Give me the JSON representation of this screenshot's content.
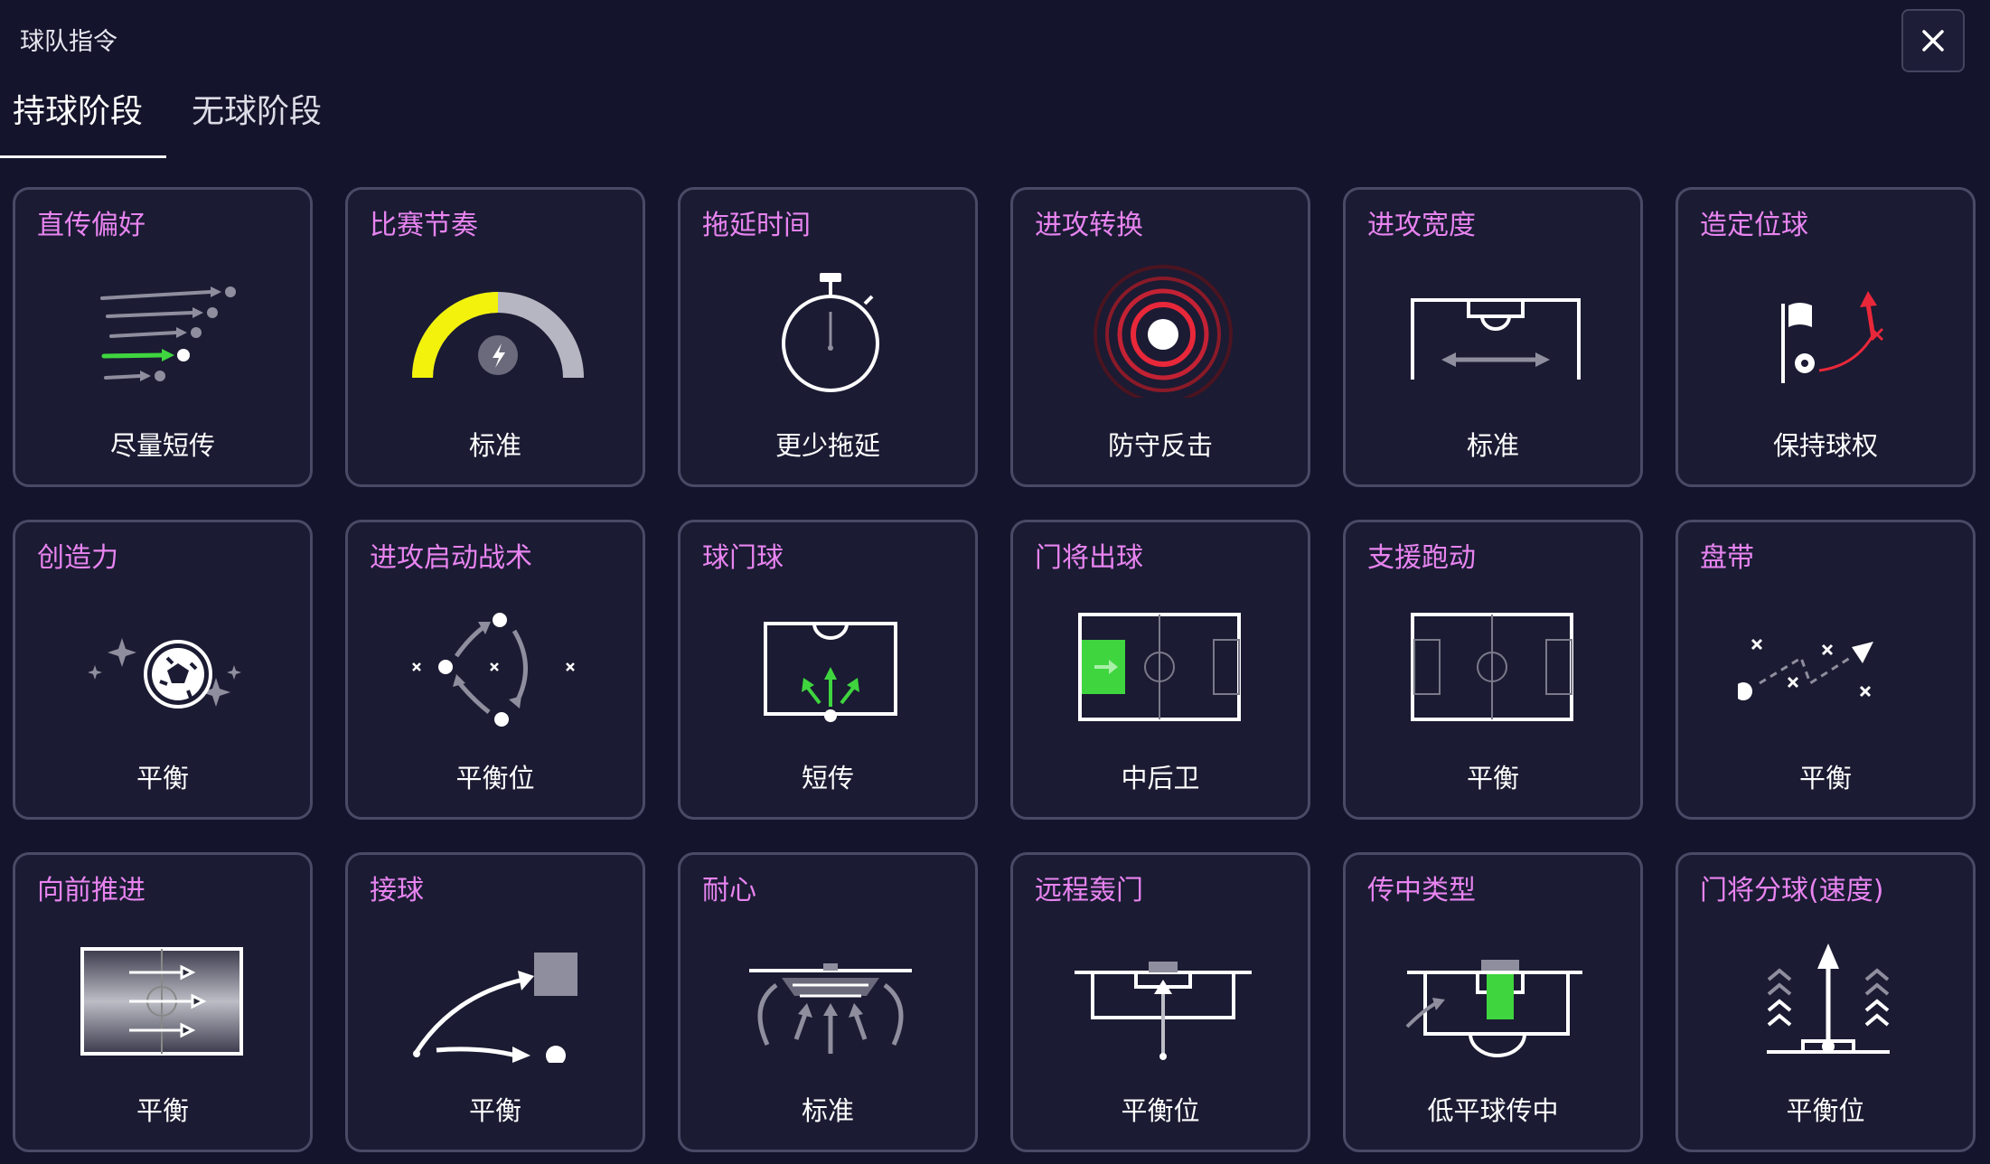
{
  "header": {
    "title": "球队指令",
    "close_icon": "close-icon"
  },
  "tabs": [
    {
      "label": "持球阶段",
      "active": true
    },
    {
      "label": "无球阶段",
      "active": false
    }
  ],
  "colors": {
    "accent_title": "#e884f0",
    "background": "#14142c",
    "card": "#1b1b33",
    "highlight_green": "#3fd53f",
    "highlight_yellow": "#f2f20c",
    "highlight_red": "#e8283a"
  },
  "cards": [
    {
      "title": "直传偏好",
      "value": "尽量短传",
      "icon": "passing-icon"
    },
    {
      "title": "比赛节奏",
      "value": "标准",
      "icon": "tempo-gauge-icon"
    },
    {
      "title": "拖延时间",
      "value": "更少拖延",
      "icon": "stopwatch-icon"
    },
    {
      "title": "进攻转换",
      "value": "防守反击",
      "icon": "target-icon"
    },
    {
      "title": "进攻宽度",
      "value": "标准",
      "icon": "width-pitch-icon"
    },
    {
      "title": "造定位球",
      "value": "保持球权",
      "icon": "set-piece-flag-icon"
    },
    {
      "title": "创造力",
      "value": "平衡",
      "icon": "creativity-ball-icon"
    },
    {
      "title": "进攻启动战术",
      "value": "平衡位",
      "icon": "build-up-icon"
    },
    {
      "title": "球门球",
      "value": "短传",
      "icon": "goal-kick-icon"
    },
    {
      "title": "门将出球",
      "value": "中后卫",
      "icon": "keeper-distribution-icon"
    },
    {
      "title": "支援跑动",
      "value": "平衡",
      "icon": "support-runs-icon"
    },
    {
      "title": "盘带",
      "value": "平衡",
      "icon": "dribbling-icon"
    },
    {
      "title": "向前推进",
      "value": "平衡",
      "icon": "progress-forward-icon"
    },
    {
      "title": "接球",
      "value": "平衡",
      "icon": "receiving-icon"
    },
    {
      "title": "耐心",
      "value": "标准",
      "icon": "patience-icon"
    },
    {
      "title": "远程轰门",
      "value": "平衡位",
      "icon": "long-shot-icon"
    },
    {
      "title": "传中类型",
      "value": "低平球传中",
      "icon": "crossing-icon"
    },
    {
      "title": "门将分球(速度)",
      "value": "平衡位",
      "icon": "keeper-speed-icon"
    }
  ]
}
